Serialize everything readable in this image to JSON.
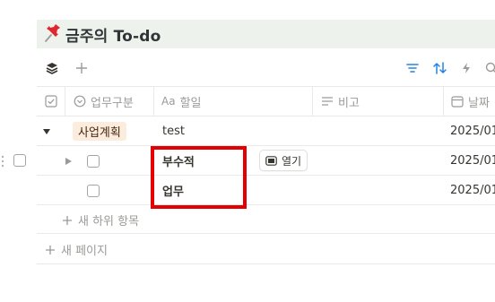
{
  "page": {
    "title": "금주의 To-do",
    "title_bg": "#edf3ec"
  },
  "toolbar": {
    "left_icons": [
      "layers-icon",
      "plus-icon"
    ],
    "right_icons": [
      "filter-icon",
      "sort-icon",
      "lightning-icon",
      "search-icon"
    ],
    "accent": "#2383e2"
  },
  "columns": {
    "category": "업무구분",
    "task_prefix": "Aa",
    "task": "할일",
    "notes": "비고",
    "date": "날짜"
  },
  "rows": [
    {
      "category": "사업계획",
      "task": "test",
      "date": "2025/01"
    },
    {
      "task": "부수적",
      "open_label": "열기",
      "date": "2025/01"
    },
    {
      "task": "업무",
      "date": "2025/01"
    }
  ],
  "actions": {
    "new_subitem": "새 하위 항목",
    "new_page": "새 페이지"
  },
  "colors": {
    "tag_bg": "#fbecdd",
    "highlight": "#e40000"
  }
}
